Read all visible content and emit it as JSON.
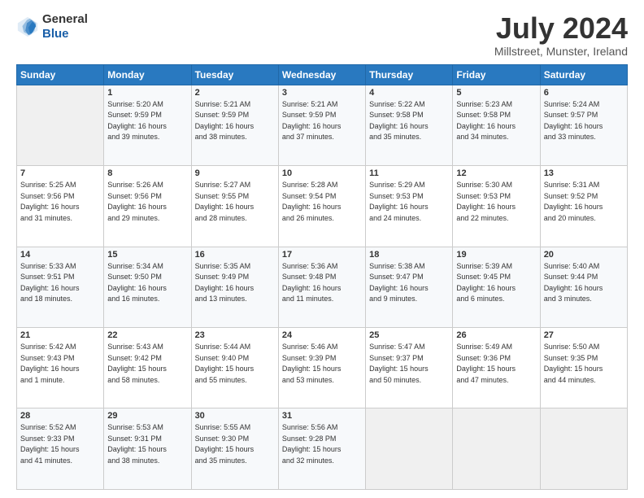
{
  "header": {
    "logo_general": "General",
    "logo_blue": "Blue",
    "month_year": "July 2024",
    "location": "Millstreet, Munster, Ireland"
  },
  "weekdays": [
    "Sunday",
    "Monday",
    "Tuesday",
    "Wednesday",
    "Thursday",
    "Friday",
    "Saturday"
  ],
  "weeks": [
    [
      {
        "day": "",
        "info": ""
      },
      {
        "day": "1",
        "info": "Sunrise: 5:20 AM\nSunset: 9:59 PM\nDaylight: 16 hours\nand 39 minutes."
      },
      {
        "day": "2",
        "info": "Sunrise: 5:21 AM\nSunset: 9:59 PM\nDaylight: 16 hours\nand 38 minutes."
      },
      {
        "day": "3",
        "info": "Sunrise: 5:21 AM\nSunset: 9:59 PM\nDaylight: 16 hours\nand 37 minutes."
      },
      {
        "day": "4",
        "info": "Sunrise: 5:22 AM\nSunset: 9:58 PM\nDaylight: 16 hours\nand 35 minutes."
      },
      {
        "day": "5",
        "info": "Sunrise: 5:23 AM\nSunset: 9:58 PM\nDaylight: 16 hours\nand 34 minutes."
      },
      {
        "day": "6",
        "info": "Sunrise: 5:24 AM\nSunset: 9:57 PM\nDaylight: 16 hours\nand 33 minutes."
      }
    ],
    [
      {
        "day": "7",
        "info": "Sunrise: 5:25 AM\nSunset: 9:56 PM\nDaylight: 16 hours\nand 31 minutes."
      },
      {
        "day": "8",
        "info": "Sunrise: 5:26 AM\nSunset: 9:56 PM\nDaylight: 16 hours\nand 29 minutes."
      },
      {
        "day": "9",
        "info": "Sunrise: 5:27 AM\nSunset: 9:55 PM\nDaylight: 16 hours\nand 28 minutes."
      },
      {
        "day": "10",
        "info": "Sunrise: 5:28 AM\nSunset: 9:54 PM\nDaylight: 16 hours\nand 26 minutes."
      },
      {
        "day": "11",
        "info": "Sunrise: 5:29 AM\nSunset: 9:53 PM\nDaylight: 16 hours\nand 24 minutes."
      },
      {
        "day": "12",
        "info": "Sunrise: 5:30 AM\nSunset: 9:53 PM\nDaylight: 16 hours\nand 22 minutes."
      },
      {
        "day": "13",
        "info": "Sunrise: 5:31 AM\nSunset: 9:52 PM\nDaylight: 16 hours\nand 20 minutes."
      }
    ],
    [
      {
        "day": "14",
        "info": "Sunrise: 5:33 AM\nSunset: 9:51 PM\nDaylight: 16 hours\nand 18 minutes."
      },
      {
        "day": "15",
        "info": "Sunrise: 5:34 AM\nSunset: 9:50 PM\nDaylight: 16 hours\nand 16 minutes."
      },
      {
        "day": "16",
        "info": "Sunrise: 5:35 AM\nSunset: 9:49 PM\nDaylight: 16 hours\nand 13 minutes."
      },
      {
        "day": "17",
        "info": "Sunrise: 5:36 AM\nSunset: 9:48 PM\nDaylight: 16 hours\nand 11 minutes."
      },
      {
        "day": "18",
        "info": "Sunrise: 5:38 AM\nSunset: 9:47 PM\nDaylight: 16 hours\nand 9 minutes."
      },
      {
        "day": "19",
        "info": "Sunrise: 5:39 AM\nSunset: 9:45 PM\nDaylight: 16 hours\nand 6 minutes."
      },
      {
        "day": "20",
        "info": "Sunrise: 5:40 AM\nSunset: 9:44 PM\nDaylight: 16 hours\nand 3 minutes."
      }
    ],
    [
      {
        "day": "21",
        "info": "Sunrise: 5:42 AM\nSunset: 9:43 PM\nDaylight: 16 hours\nand 1 minute."
      },
      {
        "day": "22",
        "info": "Sunrise: 5:43 AM\nSunset: 9:42 PM\nDaylight: 15 hours\nand 58 minutes."
      },
      {
        "day": "23",
        "info": "Sunrise: 5:44 AM\nSunset: 9:40 PM\nDaylight: 15 hours\nand 55 minutes."
      },
      {
        "day": "24",
        "info": "Sunrise: 5:46 AM\nSunset: 9:39 PM\nDaylight: 15 hours\nand 53 minutes."
      },
      {
        "day": "25",
        "info": "Sunrise: 5:47 AM\nSunset: 9:37 PM\nDaylight: 15 hours\nand 50 minutes."
      },
      {
        "day": "26",
        "info": "Sunrise: 5:49 AM\nSunset: 9:36 PM\nDaylight: 15 hours\nand 47 minutes."
      },
      {
        "day": "27",
        "info": "Sunrise: 5:50 AM\nSunset: 9:35 PM\nDaylight: 15 hours\nand 44 minutes."
      }
    ],
    [
      {
        "day": "28",
        "info": "Sunrise: 5:52 AM\nSunset: 9:33 PM\nDaylight: 15 hours\nand 41 minutes."
      },
      {
        "day": "29",
        "info": "Sunrise: 5:53 AM\nSunset: 9:31 PM\nDaylight: 15 hours\nand 38 minutes."
      },
      {
        "day": "30",
        "info": "Sunrise: 5:55 AM\nSunset: 9:30 PM\nDaylight: 15 hours\nand 35 minutes."
      },
      {
        "day": "31",
        "info": "Sunrise: 5:56 AM\nSunset: 9:28 PM\nDaylight: 15 hours\nand 32 minutes."
      },
      {
        "day": "",
        "info": ""
      },
      {
        "day": "",
        "info": ""
      },
      {
        "day": "",
        "info": ""
      }
    ]
  ]
}
